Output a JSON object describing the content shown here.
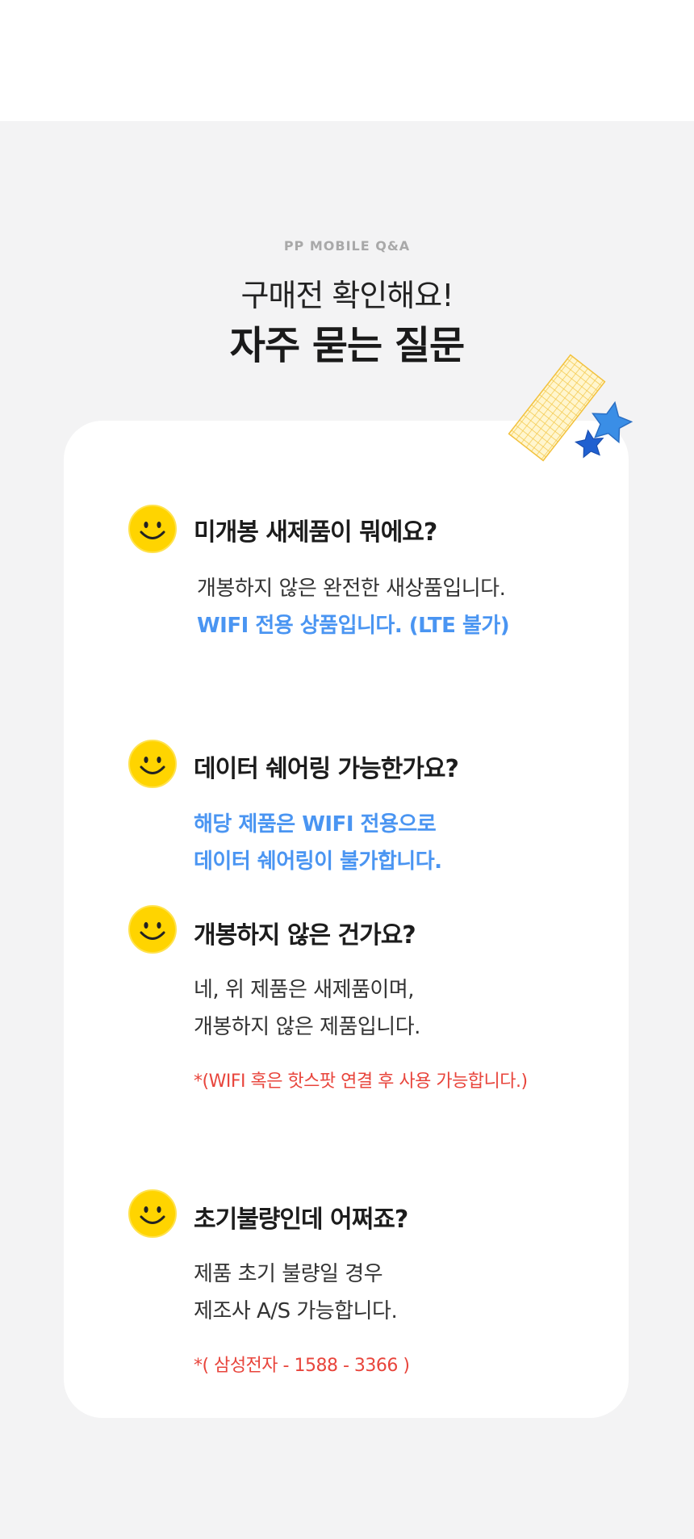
{
  "header": {
    "eyebrow": "PP MOBILE Q&A",
    "title_line1": "구매전 확인해요!",
    "title_line2": "자주 묻는 질문"
  },
  "faq": [
    {
      "question": "미개봉 새제품이 뭐에요?",
      "answer_line1": "개봉하지 않은 완전한 새상품입니다.",
      "answer_highlight": "WIFI 전용 상품입니다. (LTE 불가)"
    },
    {
      "question": "데이터 쉐어링 가능한가요?",
      "answer_highlight_line1": "해당 제품은 WIFI 전용으로",
      "answer_highlight_line2": "데이터 쉐어링이 불가합니다."
    },
    {
      "question": "개봉하지 않은 건가요?",
      "answer_line1": "네, 위 제품은 새제품이며,",
      "answer_line2": "개봉하지 않은 제품입니다.",
      "note": "*(WIFI 혹은 핫스팟 연결 후 사용 가능합니다.)"
    },
    {
      "question": "초기불량인데 어쩌죠?",
      "answer_line1": "제품 초기 불량일 경우",
      "answer_line2": "제조사 A/S 가능합니다.",
      "note": "*( 삼성전자 - 1588 - 3366 )"
    }
  ],
  "colors": {
    "background_gray": "#f3f3f4",
    "card": "#ffffff",
    "highlight_blue": "#4a95f2",
    "note_red": "#e8453c",
    "smiley_yellow": "#ffd400",
    "star_blue": "#3a8ee6"
  },
  "icons": [
    "smiley-icon",
    "star-icon",
    "tape-decoration"
  ]
}
